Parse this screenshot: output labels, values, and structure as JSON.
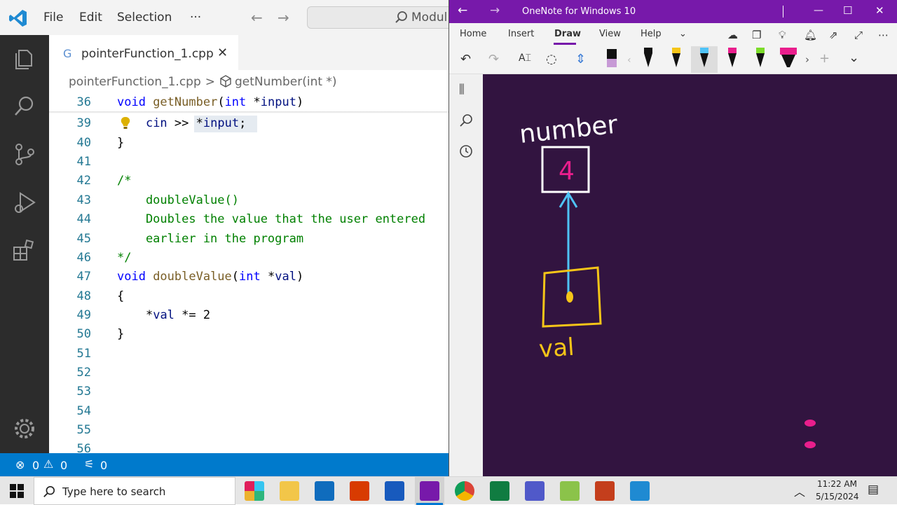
{
  "vscode": {
    "menu": [
      "File",
      "Edit",
      "Selection",
      "···"
    ],
    "command_center": "Modul",
    "tab": {
      "label": "pointerFunction_1.cpp",
      "icon": "G"
    },
    "breadcrumb": {
      "file": "pointerFunction_1.cpp",
      "symbol": "getNumber(int *)"
    },
    "lines": [
      {
        "n": "36",
        "parts": [
          [
            "kw",
            "void "
          ],
          [
            "fn",
            "getNumber"
          ],
          [
            "op",
            "("
          ],
          [
            "kw",
            "int "
          ],
          [
            "op",
            "*"
          ],
          [
            "var",
            "input"
          ],
          [
            "op",
            ")"
          ]
        ]
      },
      {
        "n": "39",
        "parts": [
          [
            "op",
            "    "
          ],
          [
            "var",
            "cin"
          ],
          [
            "op",
            " >> "
          ],
          [
            "op",
            "*"
          ],
          [
            "var",
            "input"
          ],
          [
            "op",
            ";"
          ]
        ]
      },
      {
        "n": "40",
        "parts": [
          [
            "op",
            "}"
          ]
        ]
      },
      {
        "n": "41",
        "parts": []
      },
      {
        "n": "42",
        "parts": [
          [
            "cm",
            "/*"
          ]
        ]
      },
      {
        "n": "43",
        "parts": [
          [
            "cm",
            "    doubleValue()"
          ]
        ]
      },
      {
        "n": "44",
        "parts": [
          [
            "cm",
            "    Doubles the value that the user entered"
          ]
        ]
      },
      {
        "n": "45",
        "parts": [
          [
            "cm",
            "    earlier in the program"
          ]
        ]
      },
      {
        "n": "46",
        "parts": [
          [
            "cm",
            "*/"
          ]
        ]
      },
      {
        "n": "47",
        "parts": [
          [
            "kw",
            "void "
          ],
          [
            "fn",
            "doubleValue"
          ],
          [
            "op",
            "("
          ],
          [
            "kw",
            "int "
          ],
          [
            "op",
            "*"
          ],
          [
            "var",
            "val"
          ],
          [
            "op",
            ")"
          ]
        ]
      },
      {
        "n": "48",
        "parts": [
          [
            "op",
            "{"
          ]
        ]
      },
      {
        "n": "49",
        "parts": [
          [
            "op",
            "    "
          ],
          [
            "op",
            "*"
          ],
          [
            "var",
            "val"
          ],
          [
            "op",
            " *= "
          ],
          [
            "op",
            "2"
          ]
        ]
      },
      {
        "n": "50",
        "parts": [
          [
            "op",
            "}"
          ]
        ]
      },
      {
        "n": "51",
        "parts": []
      },
      {
        "n": "52",
        "parts": []
      },
      {
        "n": "53",
        "parts": []
      },
      {
        "n": "54",
        "parts": []
      },
      {
        "n": "55",
        "parts": []
      },
      {
        "n": "56",
        "parts": []
      }
    ],
    "status": {
      "errors": "0",
      "warnings": "0",
      "ports": "0"
    }
  },
  "onenote": {
    "title": "OneNote for Windows 10",
    "tabs": [
      "Home",
      "Insert",
      "Draw",
      "View",
      "Help"
    ],
    "active_tab": "Draw",
    "drawing": {
      "top_label": "number",
      "box_value": "4",
      "bottom_label": "val"
    },
    "colors": {
      "title_bar": "#7719aa",
      "canvas": "#321440",
      "ink_white": "#ffffff",
      "ink_blue": "#4fc3f7",
      "ink_yellow": "#f5c518",
      "ink_pink": "#e91e8c"
    }
  },
  "taskbar": {
    "search_placeholder": "Type here to search",
    "time": "11:22 AM",
    "date": "5/15/2024",
    "apps": [
      "slack-icon",
      "file-explorer-icon",
      "outlook-icon",
      "app-icon",
      "word-icon",
      "onenote-icon",
      "chrome-icon",
      "excel-icon",
      "teams-icon",
      "notepad-icon",
      "powerpoint-icon",
      "vscode-icon"
    ]
  }
}
